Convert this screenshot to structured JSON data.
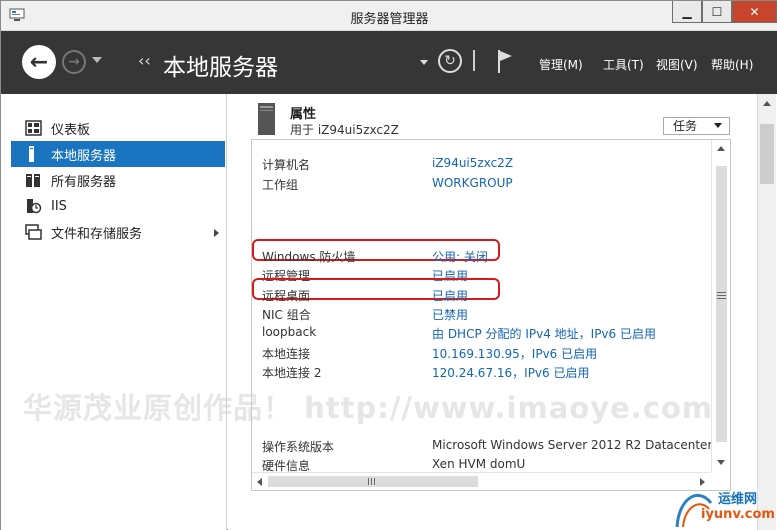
{
  "window": {
    "title": "服务器管理器",
    "min_glyph": "▁",
    "max_glyph": "☐",
    "close_glyph": "✕"
  },
  "toolbar": {
    "back_glyph": "←",
    "forward_glyph": "→",
    "breadcrumb_sep": "‹‹",
    "breadcrumb_title": "本地服务器",
    "refresh_glyph": "↻",
    "menus": [
      "管理(M)",
      "工具(T)",
      "视图(V)",
      "帮助(H)"
    ]
  },
  "sidebar": {
    "items": [
      {
        "label": "仪表板",
        "icon": "dashboard-icon"
      },
      {
        "label": "本地服务器",
        "icon": "local-server-icon",
        "active": true
      },
      {
        "label": "所有服务器",
        "icon": "all-servers-icon"
      },
      {
        "label": "IIS",
        "icon": "iis-icon"
      },
      {
        "label": "文件和存储服务",
        "icon": "file-storage-icon",
        "expandable": true
      }
    ]
  },
  "properties": {
    "title": "属性",
    "subtitle": "用于 iZ94ui5zxc2Z",
    "tasks_label": "任务",
    "rows": [
      {
        "label": "计算机名",
        "value": "iZ94ui5zxc2Z"
      },
      {
        "label": "工作组",
        "value": "WORKGROUP"
      },
      {
        "label": "Windows 防火墙",
        "value": "公用: 关闭",
        "highlight": true
      },
      {
        "label": "远程管理",
        "value": "已启用"
      },
      {
        "label": "远程桌面",
        "value": "已启用",
        "highlight": true
      },
      {
        "label": "NIC 组合",
        "value": "已禁用"
      },
      {
        "label": "loopback",
        "value": "由 DHCP 分配的 IPv4 地址，IPv6 已启用"
      },
      {
        "label": "本地连接",
        "value": "10.169.130.95，IPv6 已启用"
      },
      {
        "label": "本地连接 2",
        "value": "120.24.67.16，IPv6 已启用"
      },
      {
        "label": "操作系统版本",
        "value": "Microsoft Windows Server 2012 R2 Datacenter"
      },
      {
        "label": "硬件信息",
        "value": "Xen HVM domU"
      }
    ]
  },
  "watermark": "华源茂业原创作品！ http://www.imaoye.com",
  "site": {
    "name": "运维网",
    "url": "iyunv.com"
  },
  "colors": {
    "accent": "#1b74c0",
    "toolbar": "#363636",
    "link": "#1466b4",
    "highlight": "#d41c1c"
  }
}
